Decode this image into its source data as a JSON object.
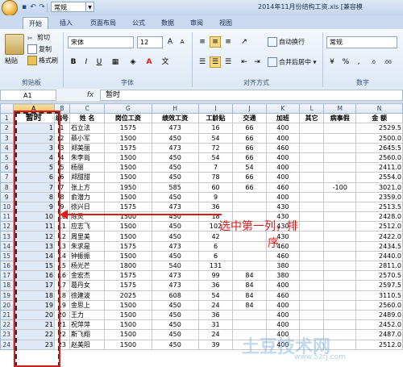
{
  "window": {
    "title": "2014年11月份结构工资.xls [兼容模"
  },
  "qat": {
    "style_value": "常规"
  },
  "tabs": [
    "开始",
    "插入",
    "页面布局",
    "公式",
    "数据",
    "审阅",
    "视图"
  ],
  "ribbon": {
    "clipboard": {
      "paste": "粘贴",
      "cut": "剪切",
      "copy": "复制",
      "format_painter": "格式刷",
      "label": "剪贴板"
    },
    "font": {
      "name": "宋体",
      "size": "12",
      "label": "字体",
      "bold": "B",
      "italic": "I",
      "underline": "U",
      "grow": "A",
      "shrink": "A",
      "color_a": "A",
      "wen": "文"
    },
    "alignment": {
      "wrap": "自动换行",
      "merge": "合并后居中",
      "label": "对齐方式"
    },
    "number": {
      "format": "常规",
      "label": "数字",
      "percent": "%",
      "comma": ",",
      "inc": ".0",
      "dec": ".00"
    }
  },
  "formula_bar": {
    "name_box": "A1",
    "fx": "fx",
    "content": "暂时"
  },
  "sheet": {
    "columns": [
      "A",
      "B",
      "C",
      "G",
      "H",
      "I",
      "J",
      "K",
      "L",
      "M",
      "N"
    ],
    "header_row": [
      "暂时",
      "编号",
      "姓 名",
      "岗位工资",
      "绩效工资",
      "工龄贴",
      "交通",
      "加班",
      "其它",
      "病事假",
      "金 额"
    ],
    "rows": [
      [
        "1",
        "1",
        "石立法",
        "1575",
        "473",
        "16",
        "66",
        "400",
        "",
        "",
        "2529.5"
      ],
      [
        "2",
        "2",
        "蔡小军",
        "1500",
        "450",
        "54",
        "66",
        "400",
        "",
        "",
        "2500.0"
      ],
      [
        "3",
        "3",
        "郑美丽",
        "1575",
        "473",
        "72",
        "66",
        "460",
        "",
        "",
        "2645.5"
      ],
      [
        "4",
        "4",
        "朱李尚",
        "1500",
        "450",
        "54",
        "66",
        "400",
        "",
        "",
        "2560.0"
      ],
      [
        "5",
        "5",
        "杨丽",
        "1500",
        "450",
        "7",
        "54",
        "400",
        "",
        "",
        "2411.0"
      ],
      [
        "6",
        "6",
        "郑甜甜",
        "1500",
        "450",
        "78",
        "66",
        "400",
        "",
        "",
        "2554.0"
      ],
      [
        "7",
        "7",
        "张上方",
        "1950",
        "585",
        "60",
        "66",
        "460",
        "",
        "-100",
        "3021.0"
      ],
      [
        "8",
        "8",
        "俞潜力",
        "1500",
        "450",
        "9",
        "",
        "400",
        "",
        "",
        "2359.0"
      ],
      [
        "9",
        "9",
        "徐兴日",
        "1575",
        "473",
        "36",
        "",
        "430",
        "",
        "",
        "2513.5"
      ],
      [
        "10",
        "10",
        "陈灵",
        "1500",
        "450",
        "18",
        "",
        "430",
        "",
        "",
        "2428.0"
      ],
      [
        "11",
        "11",
        "应志飞",
        "1500",
        "450",
        "102",
        "",
        "430",
        "",
        "",
        "2512.0"
      ],
      [
        "12",
        "12",
        "周里美",
        "1500",
        "450",
        "42",
        "",
        "430",
        "",
        "",
        "2422.0"
      ],
      [
        "13",
        "13",
        "朱求是",
        "1575",
        "473",
        "6",
        "",
        "460",
        "",
        "",
        "2434.5"
      ],
      [
        "14",
        "14",
        "钟振振",
        "1500",
        "450",
        "6",
        "",
        "460",
        "",
        "",
        "2440.0"
      ],
      [
        "15",
        "15",
        "杨光芒",
        "1800",
        "540",
        "131",
        "",
        "380",
        "",
        "",
        "2811.0"
      ],
      [
        "16",
        "16",
        "金宏杰",
        "1575",
        "473",
        "99",
        "84",
        "380",
        "",
        "",
        "2570.5"
      ],
      [
        "17",
        "17",
        "葛丹女",
        "1575",
        "473",
        "36",
        "84",
        "400",
        "",
        "",
        "2597.5"
      ],
      [
        "18",
        "18",
        "徐建波",
        "2025",
        "608",
        "54",
        "84",
        "460",
        "",
        "",
        "3110.5"
      ],
      [
        "19",
        "19",
        "金思上",
        "1500",
        "450",
        "24",
        "84",
        "400",
        "",
        "",
        "2560.0"
      ],
      [
        "20",
        "20",
        "王力",
        "1500",
        "450",
        "36",
        "",
        "400",
        "",
        "",
        "2489.0"
      ],
      [
        "21",
        "21",
        "祝萍萍",
        "1500",
        "450",
        "31",
        "",
        "400",
        "",
        "",
        "2452.0"
      ],
      [
        "22",
        "22",
        "斯飞翔",
        "1500",
        "450",
        "24",
        "",
        "400",
        "",
        "",
        "2487.0"
      ],
      [
        "23",
        "23",
        "赵美阳",
        "1500",
        "450",
        "39",
        "",
        "400",
        "",
        "",
        "2512.0"
      ]
    ]
  },
  "annotation": {
    "line1": "选中第一列，排",
    "line2": "序"
  },
  "watermark": {
    "main": "土豆技术网",
    "sub": "www.52rj.com"
  },
  "colors": {
    "accent_red": "#e01818",
    "selection_blue": "#dfe8f6"
  }
}
